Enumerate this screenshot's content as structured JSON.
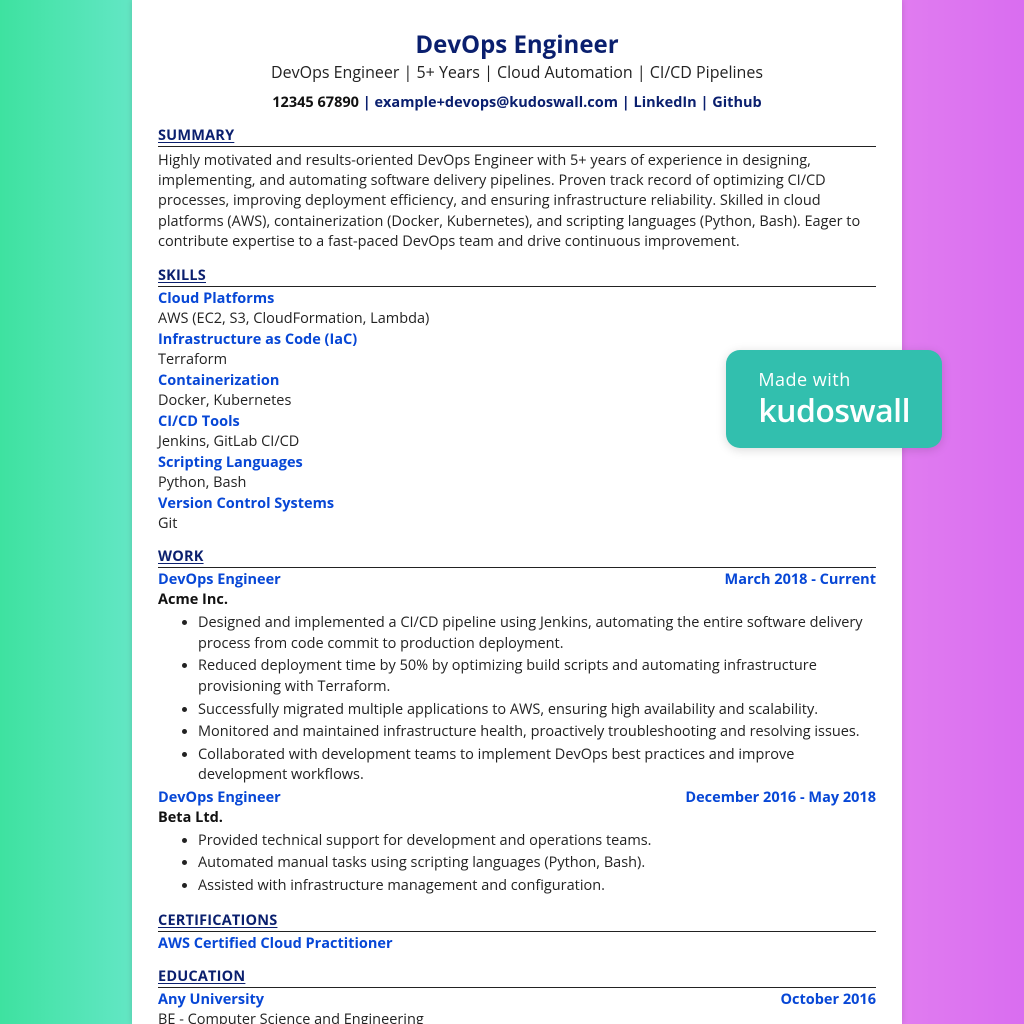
{
  "header": {
    "title": "DevOps Engineer",
    "tagline": "DevOps Engineer | 5+ Years | Cloud Automation | CI/CD Pipelines",
    "phone": "12345 67890",
    "sep": " | ",
    "email": "example+devops@kudoswall.com",
    "linkedin": "LinkedIn",
    "github": "Github"
  },
  "sections": {
    "summary_title": "SUMMARY",
    "skills_title": "SKILLS",
    "work_title": "WORK",
    "certs_title": "CERTIFICATIONS",
    "edu_title": "EDUCATION"
  },
  "summary": "Highly motivated and results-oriented DevOps Engineer with 5+ years of experience in designing, implementing, and automating software delivery pipelines. Proven track record of optimizing CI/CD processes, improving deployment efficiency, and ensuring infrastructure reliability. Skilled in cloud platforms (AWS), containerization (Docker, Kubernetes), and scripting languages (Python, Bash). Eager to contribute expertise to a fast-paced DevOps team and drive continuous improvement.",
  "skills": [
    {
      "category": "Cloud Platforms",
      "items": "AWS (EC2, S3, CloudFormation, Lambda)"
    },
    {
      "category": "Infrastructure as Code (IaC)",
      "items": "Terraform"
    },
    {
      "category": "Containerization",
      "items": "Docker, Kubernetes"
    },
    {
      "category": "CI/CD Tools",
      "items": "Jenkins, GitLab CI/CD"
    },
    {
      "category": "Scripting Languages",
      "items": "Python, Bash"
    },
    {
      "category": "Version Control Systems",
      "items": "Git"
    }
  ],
  "work": [
    {
      "title": "DevOps Engineer",
      "dates": "March 2018 - Current",
      "company": "Acme Inc.",
      "bullets": [
        "Designed and implemented a CI/CD pipeline using Jenkins, automating the entire software delivery process from code commit to production deployment.",
        "Reduced deployment time by 50% by optimizing build scripts and automating infrastructure provisioning with Terraform.",
        "Successfully migrated multiple applications to AWS, ensuring high availability and scalability.",
        "Monitored and maintained infrastructure health, proactively troubleshooting and resolving issues.",
        "Collaborated with development teams to implement DevOps best practices and improve development workflows."
      ]
    },
    {
      "title": "DevOps Engineer",
      "dates": "December 2016 - May 2018",
      "company": "Beta Ltd.",
      "bullets": [
        "Provided technical support for development and operations teams.",
        "Automated manual tasks using scripting languages (Python, Bash).",
        "Assisted with infrastructure management and configuration."
      ]
    }
  ],
  "certifications": [
    "AWS Certified Cloud Practitioner"
  ],
  "education": {
    "school": "Any University",
    "date": "October 2016",
    "degree": "BE - Computer Science and Engineering"
  },
  "badge": {
    "made_with": "Made with",
    "brand": "kudoswall"
  }
}
